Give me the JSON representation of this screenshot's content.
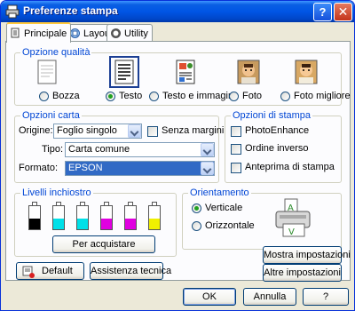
{
  "window": {
    "title": "Preferenze stampa",
    "help_symbol": "?",
    "close_symbol": "✕"
  },
  "tabs": [
    {
      "label": "Principale",
      "icon": "document-printer-icon",
      "active": true
    },
    {
      "label": "Layout",
      "icon": "layout-icon",
      "active": false
    },
    {
      "label": "Utility",
      "icon": "utility-printer-icon",
      "active": false
    }
  ],
  "quality": {
    "title": "Opzione qualità",
    "options": [
      {
        "label": "Bozza",
        "checked": false,
        "icon": "draft-document-icon"
      },
      {
        "label": "Testo",
        "checked": true,
        "icon": "text-document-icon"
      },
      {
        "label": "Testo e immagine",
        "checked": false,
        "icon": "text-image-document-icon"
      },
      {
        "label": "Foto",
        "checked": false,
        "icon": "photo-icon"
      },
      {
        "label": "Foto migliore",
        "checked": false,
        "icon": "best-photo-icon"
      }
    ]
  },
  "paper": {
    "title": "Opzioni carta",
    "origin_label": "Origine:",
    "origin_value": "Foglio singolo",
    "borderless_label": "Senza margini",
    "borderless_checked": false,
    "type_label": "Tipo:",
    "type_value": "Carta comune",
    "format_label": "Formato:",
    "format_value": "EPSON"
  },
  "print_options": {
    "title": "Opzioni di stampa",
    "items": [
      {
        "label": "PhotoEnhance",
        "checked": false
      },
      {
        "label": "Ordine inverso",
        "checked": false
      },
      {
        "label": "Anteprima di stampa",
        "checked": false
      }
    ]
  },
  "ink": {
    "title": "Livelli inchiostro",
    "cartridges": [
      {
        "color_name": "black",
        "color": "#000000",
        "level": 0.45
      },
      {
        "color_name": "cyan",
        "color": "#00e0e8",
        "level": 0.45
      },
      {
        "color_name": "light cyan",
        "color": "#00e0e8",
        "level": 0.45
      },
      {
        "color_name": "magenta",
        "color": "#e000e0",
        "level": 0.45
      },
      {
        "color_name": "light magenta",
        "color": "#e000e0",
        "level": 0.45
      },
      {
        "color_name": "yellow",
        "color": "#f0f000",
        "level": 0.45
      }
    ],
    "purchase_button": "Per acquistare"
  },
  "orientation": {
    "title": "Orientamento",
    "options": [
      {
        "label": "Verticale",
        "checked": true
      },
      {
        "label": "Orizzontale",
        "checked": false
      }
    ],
    "preview_icon": "printer-portrait-icon"
  },
  "buttons": {
    "default": "Default",
    "technical_support": "Assistenza tecnica",
    "show_settings": "Mostra impostazioni",
    "other_settings": "Altre impostazioni",
    "ok": "OK",
    "cancel": "Annulla",
    "help": "?"
  }
}
